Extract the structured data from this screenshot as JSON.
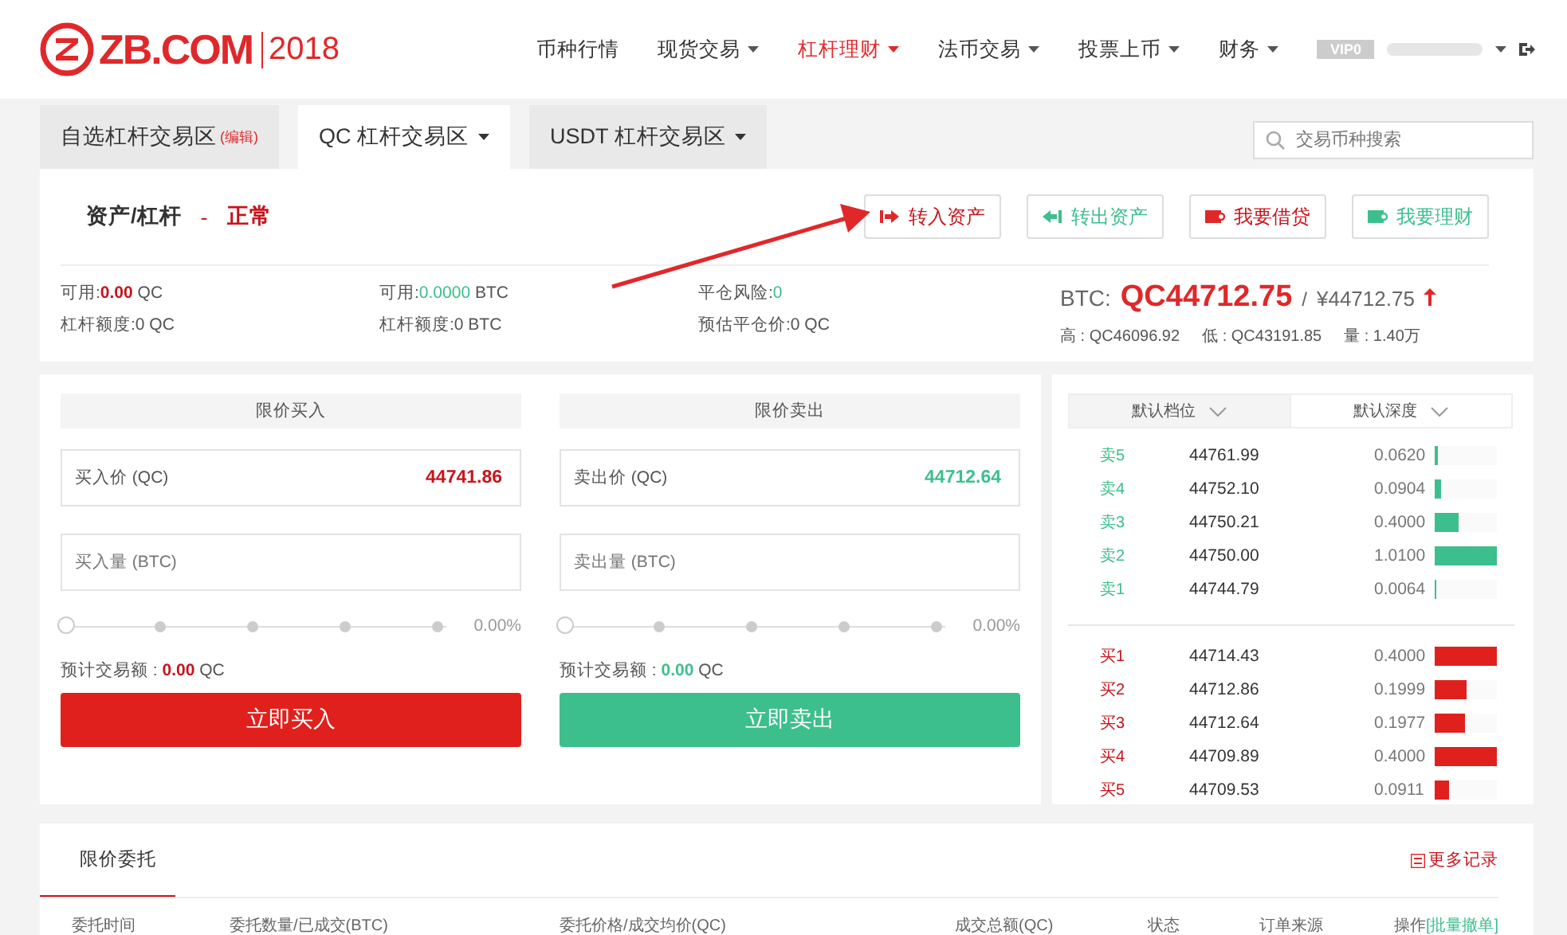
{
  "logo": {
    "brand": "ZB.COM",
    "year": "2018"
  },
  "nav": [
    {
      "label": "币种行情",
      "dropdown": false,
      "selected": false
    },
    {
      "label": "现货交易",
      "dropdown": true,
      "selected": false
    },
    {
      "label": "杠杆理财",
      "dropdown": true,
      "selected": true
    },
    {
      "label": "法币交易",
      "dropdown": true,
      "selected": false
    },
    {
      "label": "投票上币",
      "dropdown": true,
      "selected": false
    },
    {
      "label": "财务",
      "dropdown": true,
      "selected": false
    }
  ],
  "account": {
    "badge": "VIP0"
  },
  "market_tabs": [
    {
      "label": "自选杠杆交易区",
      "note": "(编辑)",
      "dropdown": false,
      "selected": false
    },
    {
      "label": "QC 杠杆交易区",
      "dropdown": true,
      "selected": true
    },
    {
      "label": "USDT 杠杆交易区",
      "dropdown": true,
      "selected": false
    }
  ],
  "search": {
    "placeholder": "交易币种搜索"
  },
  "asset": {
    "title": "资产/杠杆",
    "separator": "-",
    "status": "正常",
    "actions": [
      {
        "label": "转入资产",
        "kind": "transfer_in"
      },
      {
        "label": "转出资产",
        "kind": "transfer_out"
      },
      {
        "label": "我要借贷",
        "kind": "borrow"
      },
      {
        "label": "我要理财",
        "kind": "invest"
      }
    ],
    "stats": [
      {
        "label": "可用:",
        "value": "0.00",
        "unit": "QC",
        "kind": "down"
      },
      {
        "label": "杠杆额度:",
        "value": "0",
        "unit": "QC",
        "kind": "plain"
      },
      {
        "label": "可用:",
        "value": "0.0000",
        "unit": "BTC",
        "kind": "up"
      },
      {
        "label": "杠杆额度:",
        "value": "0",
        "unit": "BTC",
        "kind": "plain"
      },
      {
        "label": "平仓风险:",
        "value": "0",
        "kind": "up"
      },
      {
        "label": "预估平仓价:",
        "value": "0",
        "unit": "QC",
        "kind": "plain"
      }
    ]
  },
  "ticker": {
    "pair": "BTC:",
    "price": "QC44712.75",
    "separator": "/",
    "cny": "¥44712.75",
    "rising": true,
    "stats": [
      "高 : QC46096.92",
      "低 : QC43191.85",
      "量 : 1.40万"
    ]
  },
  "orders": [
    {
      "kind": "buy",
      "heading": "限价买入",
      "price_label": "买入价 (QC)",
      "price": "44741.86",
      "amount_placeholder": "买入量 (BTC)",
      "level": 0,
      "percent": "0.00%",
      "total_label": "预计交易额 :",
      "total": "0.00",
      "total_unit": "QC",
      "submit": "立即买入"
    },
    {
      "kind": "sell",
      "heading": "限价卖出",
      "price_label": "卖出价 (QC)",
      "price": "44712.64",
      "amount_placeholder": "卖出量 (BTC)",
      "level": 0,
      "percent": "0.00%",
      "total_label": "预计交易额 :",
      "total": "0.00",
      "total_unit": "QC",
      "submit": "立即卖出"
    }
  ],
  "book": {
    "selectors": [
      "默认档位",
      "默认深度"
    ],
    "asks": [
      {
        "label": "卖5",
        "price": "44761.99",
        "amount": "0.0620",
        "level": 0.06
      },
      {
        "label": "卖4",
        "price": "44752.10",
        "amount": "0.0904",
        "level": 0.09
      },
      {
        "label": "卖3",
        "price": "44750.21",
        "amount": "0.4000",
        "level": 0.39
      },
      {
        "label": "卖2",
        "price": "44750.00",
        "amount": "1.0100",
        "level": 1
      },
      {
        "label": "卖1",
        "price": "44744.79",
        "amount": "0.0064",
        "level": 0.02
      }
    ],
    "bids": [
      {
        "label": "买1",
        "price": "44714.43",
        "amount": "0.4000",
        "level": 1
      },
      {
        "label": "买2",
        "price": "44712.86",
        "amount": "0.1999",
        "level": 0.5
      },
      {
        "label": "买3",
        "price": "44712.64",
        "amount": "0.1977",
        "level": 0.49
      },
      {
        "label": "买4",
        "price": "44709.89",
        "amount": "0.4000",
        "level": 1
      },
      {
        "label": "买5",
        "price": "44709.53",
        "amount": "0.0911",
        "level": 0.23
      }
    ]
  },
  "history": {
    "tabs": [
      {
        "label": "限价委托",
        "selected": true
      }
    ],
    "more": "更多记录",
    "columns": [
      "委托时间",
      "委托数量/已成交(BTC)",
      "委托价格/成交均价(QC)",
      "成交总额(QC)",
      "状态",
      "订单来源",
      "操作"
    ],
    "batch_cancel": "[批量撤单]"
  }
}
